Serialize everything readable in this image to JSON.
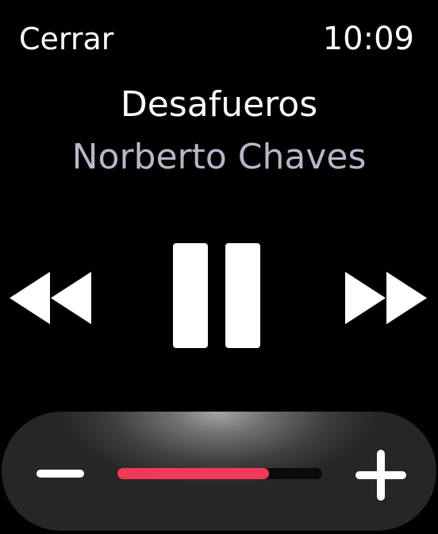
{
  "header": {
    "close_label": "Cerrar",
    "time": "10:09"
  },
  "now_playing": {
    "title": "Desafueros",
    "artist": "Norberto Chaves"
  },
  "controls": {
    "rewind_icon": "rewind-icon",
    "pause_icon": "pause-icon",
    "forward_icon": "fast-forward-icon"
  },
  "volume": {
    "level": 0.74,
    "minus_icon": "volume-down-icon",
    "plus_icon": "volume-up-icon"
  },
  "colors": {
    "background": "#000000",
    "title": "#ffffff",
    "artist": "#b4b8c8",
    "volume_fill": "#f23a56"
  }
}
